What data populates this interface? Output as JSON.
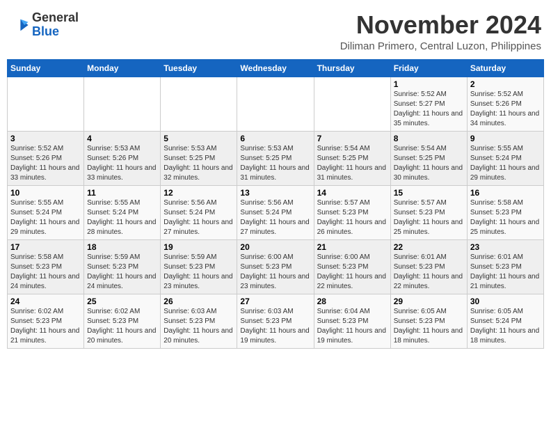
{
  "header": {
    "logo_general": "General",
    "logo_blue": "Blue",
    "month_title": "November 2024",
    "location": "Diliman Primero, Central Luzon, Philippines"
  },
  "days_of_week": [
    "Sunday",
    "Monday",
    "Tuesday",
    "Wednesday",
    "Thursday",
    "Friday",
    "Saturday"
  ],
  "weeks": [
    [
      null,
      null,
      null,
      null,
      null,
      {
        "day": "1",
        "sunrise": "5:52 AM",
        "sunset": "5:27 PM",
        "daylight": "11 hours and 35 minutes."
      },
      {
        "day": "2",
        "sunrise": "5:52 AM",
        "sunset": "5:26 PM",
        "daylight": "11 hours and 34 minutes."
      }
    ],
    [
      {
        "day": "3",
        "sunrise": "5:52 AM",
        "sunset": "5:26 PM",
        "daylight": "11 hours and 33 minutes."
      },
      {
        "day": "4",
        "sunrise": "5:53 AM",
        "sunset": "5:26 PM",
        "daylight": "11 hours and 33 minutes."
      },
      {
        "day": "5",
        "sunrise": "5:53 AM",
        "sunset": "5:25 PM",
        "daylight": "11 hours and 32 minutes."
      },
      {
        "day": "6",
        "sunrise": "5:53 AM",
        "sunset": "5:25 PM",
        "daylight": "11 hours and 31 minutes."
      },
      {
        "day": "7",
        "sunrise": "5:54 AM",
        "sunset": "5:25 PM",
        "daylight": "11 hours and 31 minutes."
      },
      {
        "day": "8",
        "sunrise": "5:54 AM",
        "sunset": "5:25 PM",
        "daylight": "11 hours and 30 minutes."
      },
      {
        "day": "9",
        "sunrise": "5:55 AM",
        "sunset": "5:24 PM",
        "daylight": "11 hours and 29 minutes."
      }
    ],
    [
      {
        "day": "10",
        "sunrise": "5:55 AM",
        "sunset": "5:24 PM",
        "daylight": "11 hours and 29 minutes."
      },
      {
        "day": "11",
        "sunrise": "5:55 AM",
        "sunset": "5:24 PM",
        "daylight": "11 hours and 28 minutes."
      },
      {
        "day": "12",
        "sunrise": "5:56 AM",
        "sunset": "5:24 PM",
        "daylight": "11 hours and 27 minutes."
      },
      {
        "day": "13",
        "sunrise": "5:56 AM",
        "sunset": "5:24 PM",
        "daylight": "11 hours and 27 minutes."
      },
      {
        "day": "14",
        "sunrise": "5:57 AM",
        "sunset": "5:23 PM",
        "daylight": "11 hours and 26 minutes."
      },
      {
        "day": "15",
        "sunrise": "5:57 AM",
        "sunset": "5:23 PM",
        "daylight": "11 hours and 25 minutes."
      },
      {
        "day": "16",
        "sunrise": "5:58 AM",
        "sunset": "5:23 PM",
        "daylight": "11 hours and 25 minutes."
      }
    ],
    [
      {
        "day": "17",
        "sunrise": "5:58 AM",
        "sunset": "5:23 PM",
        "daylight": "11 hours and 24 minutes."
      },
      {
        "day": "18",
        "sunrise": "5:59 AM",
        "sunset": "5:23 PM",
        "daylight": "11 hours and 24 minutes."
      },
      {
        "day": "19",
        "sunrise": "5:59 AM",
        "sunset": "5:23 PM",
        "daylight": "11 hours and 23 minutes."
      },
      {
        "day": "20",
        "sunrise": "6:00 AM",
        "sunset": "5:23 PM",
        "daylight": "11 hours and 23 minutes."
      },
      {
        "day": "21",
        "sunrise": "6:00 AM",
        "sunset": "5:23 PM",
        "daylight": "11 hours and 22 minutes."
      },
      {
        "day": "22",
        "sunrise": "6:01 AM",
        "sunset": "5:23 PM",
        "daylight": "11 hours and 22 minutes."
      },
      {
        "day": "23",
        "sunrise": "6:01 AM",
        "sunset": "5:23 PM",
        "daylight": "11 hours and 21 minutes."
      }
    ],
    [
      {
        "day": "24",
        "sunrise": "6:02 AM",
        "sunset": "5:23 PM",
        "daylight": "11 hours and 21 minutes."
      },
      {
        "day": "25",
        "sunrise": "6:02 AM",
        "sunset": "5:23 PM",
        "daylight": "11 hours and 20 minutes."
      },
      {
        "day": "26",
        "sunrise": "6:03 AM",
        "sunset": "5:23 PM",
        "daylight": "11 hours and 20 minutes."
      },
      {
        "day": "27",
        "sunrise": "6:03 AM",
        "sunset": "5:23 PM",
        "daylight": "11 hours and 19 minutes."
      },
      {
        "day": "28",
        "sunrise": "6:04 AM",
        "sunset": "5:23 PM",
        "daylight": "11 hours and 19 minutes."
      },
      {
        "day": "29",
        "sunrise": "6:05 AM",
        "sunset": "5:23 PM",
        "daylight": "11 hours and 18 minutes."
      },
      {
        "day": "30",
        "sunrise": "6:05 AM",
        "sunset": "5:24 PM",
        "daylight": "11 hours and 18 minutes."
      }
    ]
  ]
}
